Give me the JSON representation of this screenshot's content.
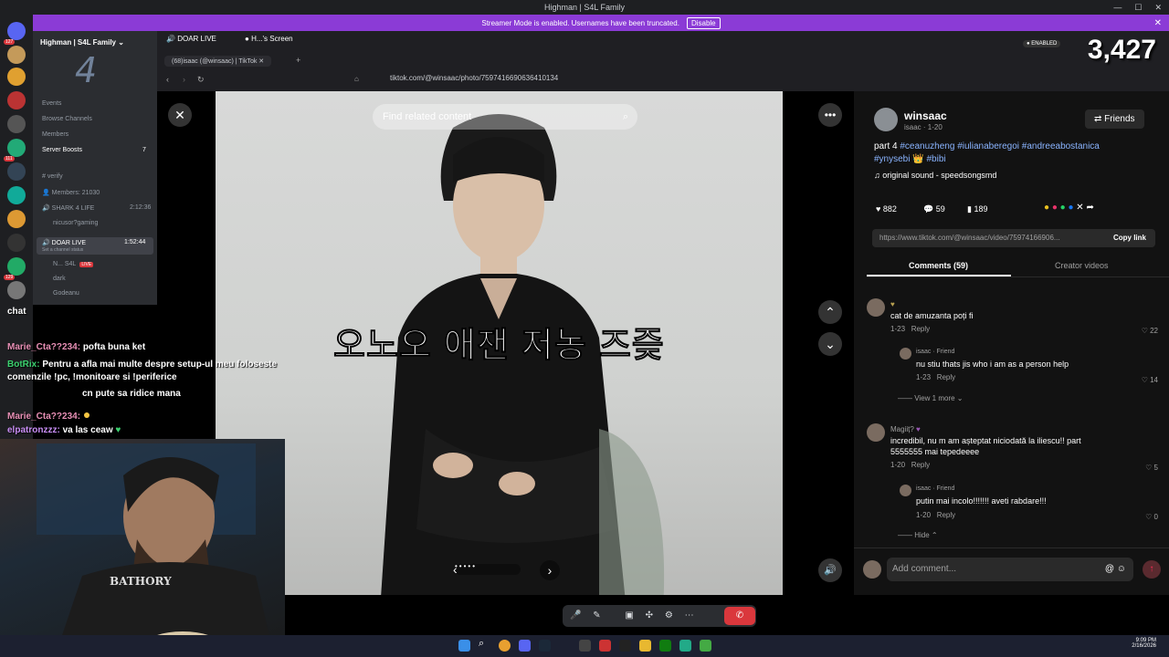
{
  "window": {
    "title": "Highman | S4L Family"
  },
  "banner": {
    "text": "Streamer Mode is enabled. Usernames have been truncated.",
    "disable": "Disable"
  },
  "rail": {
    "badges": [
      "127",
      "111",
      "408",
      "129"
    ]
  },
  "sidebar": {
    "server_name": "Highman | S4L Family",
    "items": [
      "Events",
      "Browse Channels",
      "Members",
      "Server Boosts"
    ],
    "boost_count": "7",
    "channels": [
      "verify",
      "Members: 21030",
      "SHARK 4 LIFE",
      "nicusor?gaming",
      "DOAR LIVE",
      "Set a channel status",
      "N...",
      "S4L",
      "dark",
      "Godeanu",
      "ket"
    ],
    "times": [
      "2:12:36",
      "1:52:44"
    ],
    "live": "LIVE"
  },
  "tabs": {
    "tab1": "DOAR LIVE",
    "tab2": "H...'s Screen",
    "browser_tab": "(68)isaac (@winsaac) | TikTok"
  },
  "address": "tiktok.com/@winsaac/photo/7597416690636410134",
  "video": {
    "search_placeholder": "Find related content",
    "caption": "오노오 애잰 저농 즈즞"
  },
  "post": {
    "username": "winsaac",
    "meta": "isaac · 1-20",
    "friends": "Friends",
    "desc_prefix": "part 4",
    "hashtags": "#ceanuzheng #iulianaberegoi #andreeabostanica",
    "hashtags2": "#ynysebi",
    "hashtags3": "#bibi",
    "sound": "original sound - speedsongsmd",
    "likes": "882",
    "comments": "59",
    "saves": "189",
    "link": "https://www.tiktok.com/@winsaac/video/75974166906...",
    "copy_link": "Copy link",
    "tab_comments": "Comments (59)",
    "tab_creator": "Creator videos"
  },
  "comments": [
    {
      "text": "cat de amuzanta poți fi",
      "date": "1-23",
      "reply": "Reply",
      "likes": "22"
    },
    {
      "author": "isaac · Friend",
      "text": "nu stiu thats jis who i am as a person help",
      "date": "1-23",
      "reply": "Reply",
      "likes": "14"
    },
    {
      "more": "View 1 more"
    },
    {
      "author": "Magiiț?",
      "text": "incredibil, nu m am așteptat niciodată la iliescu!! part",
      "text2": "5555555 mai tepedeeee",
      "date": "1-20",
      "reply": "Reply",
      "likes": "5"
    },
    {
      "author": "isaac · Friend",
      "text": "putin mai incolo!!!!!!! aveti rabdare!!!",
      "date": "1-20",
      "reply": "Reply",
      "likes": "0"
    },
    {
      "more": "Hide"
    }
  ],
  "add_comment": "Add comment...",
  "chat": [
    {
      "user": "Marie_Cta??234:",
      "msg": "pofta buna ket"
    },
    {
      "user": "BotRix:",
      "msg": "Pentru a afla mai multe despre setup-ul meu foloseste"
    },
    {
      "user": "",
      "msg": "comenzile !pc, !monitoare si !periferice"
    },
    {
      "user": "",
      "msg": "cn pute sa ridice mana"
    },
    {
      "user": "Marie_Cta??234:",
      "msg": ""
    },
    {
      "user": "elpatronzzz:",
      "msg": "va las ceaw"
    }
  ],
  "chat_label": "chat",
  "overlay": {
    "viewers": "3,427",
    "enabled": "ENABLED"
  },
  "clock": {
    "time": "9:09 PM",
    "date": "2/16/2026"
  }
}
